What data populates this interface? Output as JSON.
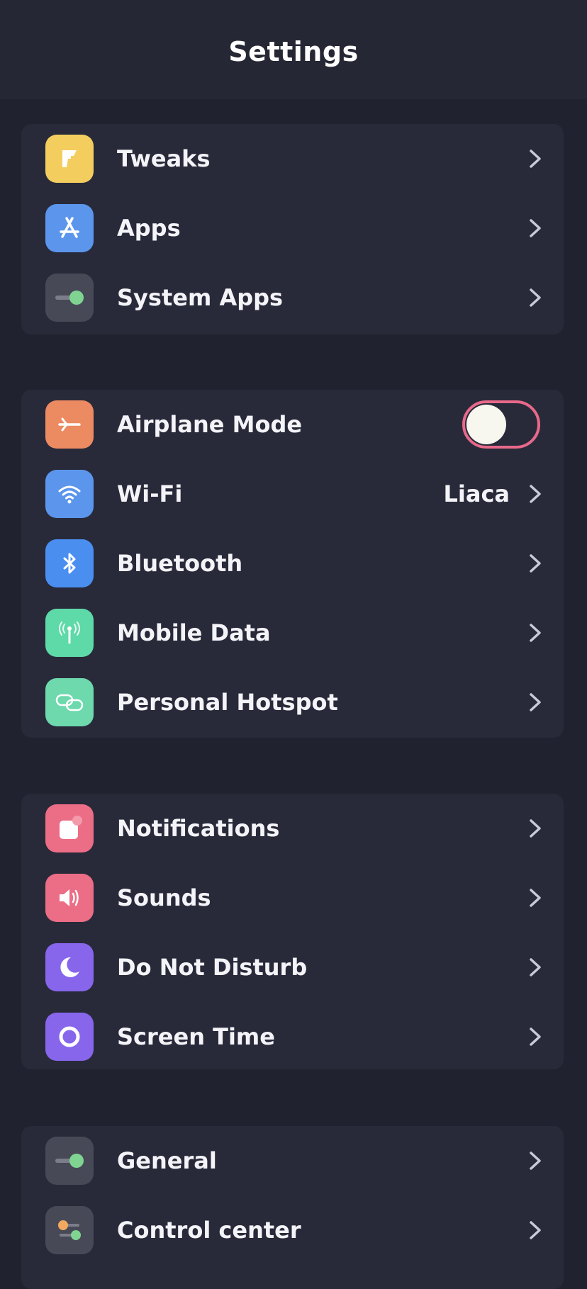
{
  "header": {
    "title": "Settings"
  },
  "groups": [
    {
      "items": [
        {
          "label": "Tweaks",
          "icon": "tweaks-icon",
          "color": "#f3cd5e"
        },
        {
          "label": "Apps",
          "icon": "app-store-icon",
          "color": "#5b96ec"
        },
        {
          "label": "System Apps",
          "icon": "toggle-switch-icon",
          "color": "#474957"
        }
      ]
    },
    {
      "items": [
        {
          "label": "Airplane Mode",
          "icon": "airplane-icon",
          "color": "#ec8a62",
          "toggle_on": false,
          "toggle_border_color": "#e8698a"
        },
        {
          "label": "Wi-Fi",
          "icon": "wifi-icon",
          "color": "#5b96ec",
          "value": "Liaca"
        },
        {
          "label": "Bluetooth",
          "icon": "bluetooth-icon",
          "color": "#4a8ef0"
        },
        {
          "label": "Mobile Data",
          "icon": "antenna-icon",
          "color": "#5ed9a8"
        },
        {
          "label": "Personal Hotspot",
          "icon": "link-icon",
          "color": "#6dd9ad"
        }
      ]
    },
    {
      "items": [
        {
          "label": "Notifications",
          "icon": "notification-badge-icon",
          "color": "#ec6e86"
        },
        {
          "label": "Sounds",
          "icon": "speaker-icon",
          "color": "#ec6e86"
        },
        {
          "label": "Do Not Disturb",
          "icon": "moon-icon",
          "color": "#8766ec"
        },
        {
          "label": "Screen Time",
          "icon": "ring-icon",
          "color": "#8766ec"
        }
      ]
    },
    {
      "items": [
        {
          "label": "General",
          "icon": "toggle-switch-icon",
          "color": "#474957"
        },
        {
          "label": "Control center",
          "icon": "sliders-icon",
          "color": "#474957"
        }
      ]
    }
  ]
}
